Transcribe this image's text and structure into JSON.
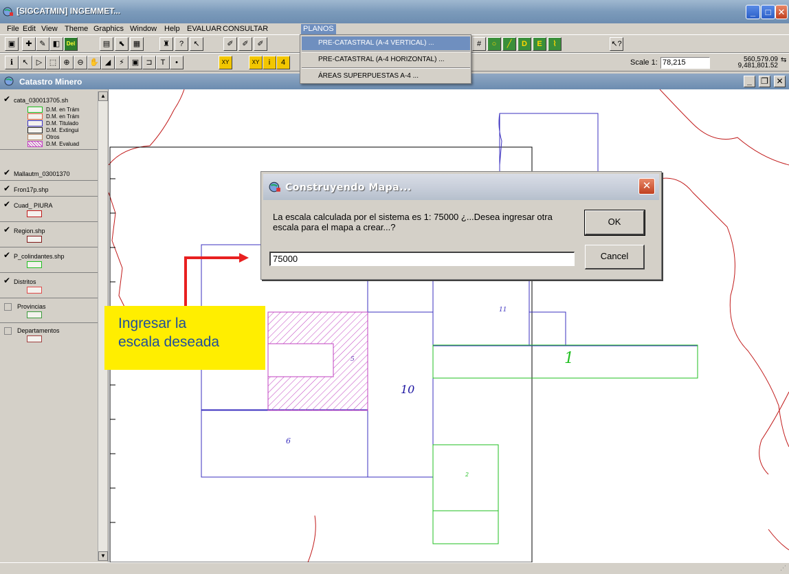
{
  "window": {
    "title": "[SIGCATMIN] INGEMMET..."
  },
  "menubar": {
    "items": [
      "File",
      "Edit",
      "View",
      "Theme",
      "Graphics",
      "Window",
      "Help",
      "EVALUAR",
      "CONSULTAR",
      "PLANOS"
    ]
  },
  "planos_menu": {
    "items": [
      "PRE-CATASTRAL (A-4 VERTICAL) ...",
      "PRE-CATASTRAL (A-4 HORIZONTAL) ...",
      "ÁREAS SUPERPUESTAS A-4 ..."
    ]
  },
  "toolbar": {
    "del_label": "Del",
    "xy_label": "XY",
    "scale_label": "Scale 1:",
    "scale_value": "78,215",
    "coord_x": "560,579.09",
    "coord_y": "9,481,801.52"
  },
  "view_window": {
    "title": "Catastro Minero"
  },
  "legend": {
    "themes": [
      {
        "name": "cata_030013705.sh",
        "checked": true
      },
      {
        "name": "Mallautm_03001370",
        "checked": true
      },
      {
        "name": "Fron17p.shp",
        "checked": true
      },
      {
        "name": "Cuad_ PIURA",
        "checked": true
      },
      {
        "name": "Region.shp",
        "checked": true
      },
      {
        "name": "P_colindantes.shp",
        "checked": true
      },
      {
        "name": "Distritos",
        "checked": true
      },
      {
        "name": "Provincias",
        "checked": false
      },
      {
        "name": "Departamentos",
        "checked": false
      }
    ],
    "cata_classes": [
      "D.M. en Trám",
      "D.M. en Trám",
      "D.M. Titulado",
      "D.M. Extingui",
      "Otros",
      "D.M. Evaluad"
    ]
  },
  "dialog": {
    "title": "Construyendo Mapa...",
    "message": "La escala calculada por el sistema es 1: 75000  ¿...Desea ingresar otra escala para el mapa a crear...?",
    "ok_label": "OK",
    "cancel_label": "Cancel",
    "input_value": "75000"
  },
  "annotation": {
    "line1": "Ingresar la",
    "line2": "escala deseada"
  },
  "map": {
    "labels": [
      "11",
      "1",
      "10",
      "5",
      "6",
      "2"
    ]
  },
  "colors": {
    "blue_parcel": "#3a2fbf",
    "green_parcel": "#1fbf1f",
    "red_boundary": "#c01818",
    "hatch": "#c040c0",
    "annotation_bg": "#ffee00"
  }
}
